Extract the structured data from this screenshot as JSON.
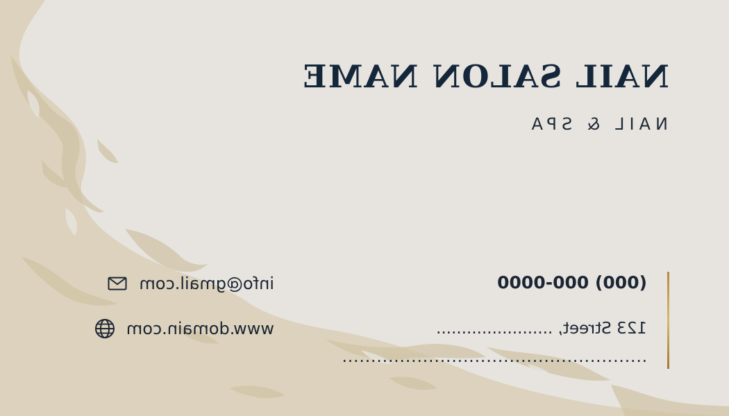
{
  "brand": {
    "name": "NAIL SALON NAME",
    "tagline": "NAIL & SPA"
  },
  "contact": {
    "phone": "(000) 000-0000",
    "address_line1": "123 Street, .......................",
    "address_line2": ".....................................................",
    "email": "info@gmail.com",
    "email_icon": "envelope-icon",
    "website": "www.domain.com",
    "website_icon": "globe-icon"
  },
  "colors": {
    "background": "#e7e4df",
    "texture": "#d8ccb2",
    "text": "#14263a",
    "accent_line": "#c9a85a"
  }
}
